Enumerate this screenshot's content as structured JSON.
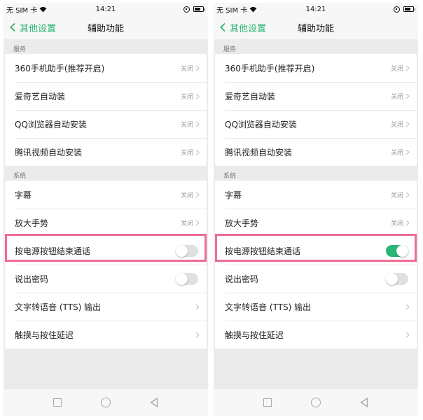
{
  "colors": {
    "accent": "#2bb673",
    "highlight": "#ef6c95"
  },
  "status": {
    "sim": "无 SIM 卡",
    "time": "14:21"
  },
  "nav": {
    "back_label": "其他设置",
    "title": "辅助功能"
  },
  "sections": {
    "services_label": "服务",
    "system_label": "系统"
  },
  "services": [
    {
      "label": "360手机助手(推荐开启)",
      "value": "关闭"
    },
    {
      "label": "爱奇艺自动装",
      "value": "关闭"
    },
    {
      "label": "QQ浏览器自动安装",
      "value": "关闭"
    },
    {
      "label": "腾讯视频自动安装",
      "value": "关闭"
    }
  ],
  "system": [
    {
      "label": "字幕",
      "value": "关闭"
    },
    {
      "label": "放大手势",
      "value": "关闭"
    },
    {
      "label": "按电源按钮结束通话"
    },
    {
      "label": "说出密码"
    },
    {
      "label": "文字转语音 (TTS) 输出"
    },
    {
      "label": "触摸与按住延迟"
    }
  ],
  "screens": [
    {
      "end_call_toggle": "off",
      "speak_password_toggle": "off"
    },
    {
      "end_call_toggle": "on",
      "speak_password_toggle": "off"
    }
  ]
}
